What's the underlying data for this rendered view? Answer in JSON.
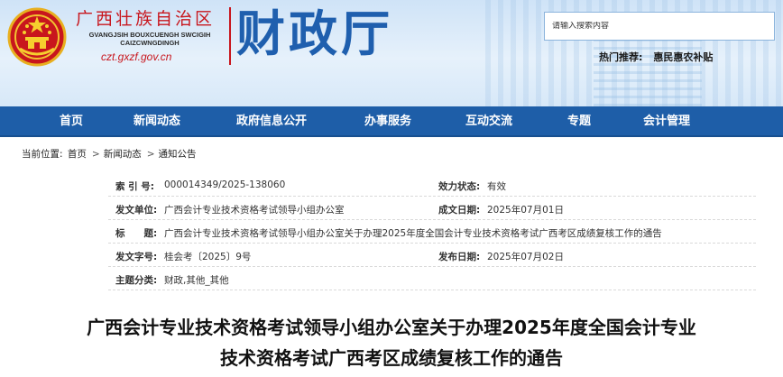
{
  "header": {
    "region_cn": "广西壮族自治区",
    "region_pinyin_1": "GVANGJSIH BOUXCUENGH SWCIGIH",
    "region_pinyin_2": "CAIZCWNGDINGH",
    "site_url": "czt.gxzf.gov.cn",
    "dept_title": "财政厅",
    "search_placeholder": "请输入搜索内容",
    "hot_label": "热门推荐:",
    "hot_link": "惠民惠农补贴",
    "accent_red": "#c8161d",
    "brand_blue": "#1e5ea8"
  },
  "nav": {
    "items": [
      "首页",
      "新闻动态",
      "政府信息公开",
      "办事服务",
      "互动交流",
      "专题",
      "会计管理"
    ]
  },
  "breadcrumb": {
    "label": "当前位置:",
    "items": [
      "首页",
      "新闻动态",
      "通知公告"
    ],
    "separator": ">"
  },
  "meta": {
    "rows": [
      {
        "k": "索 引 号:",
        "v": "000014349/2025-138060",
        "k2": "效力状态:",
        "v2": "有效"
      },
      {
        "k": "发文单位:",
        "v": "广西会计专业技术资格考试领导小组办公室",
        "k2": "成文日期:",
        "v2": "2025年07月01日"
      },
      {
        "k": "标　　题:",
        "v": "广西会计专业技术资格考试领导小组办公室关于办理2025年度全国会计专业技术资格考试广西考区成绩复核工作的通告",
        "k2": "",
        "v2": ""
      },
      {
        "k": "发文字号:",
        "v": "桂会考〔2025〕9号",
        "k2": "发布日期:",
        "v2": "2025年07月02日"
      },
      {
        "k": "主题分类:",
        "v": "财政,其他_其他",
        "k2": "",
        "v2": ""
      }
    ]
  },
  "article": {
    "title_line1": "广西会计专业技术资格考试领导小组办公室关于办理2025年度全国会计专业",
    "title_line2": "技术资格考试广西考区成绩复核工作的通告"
  }
}
